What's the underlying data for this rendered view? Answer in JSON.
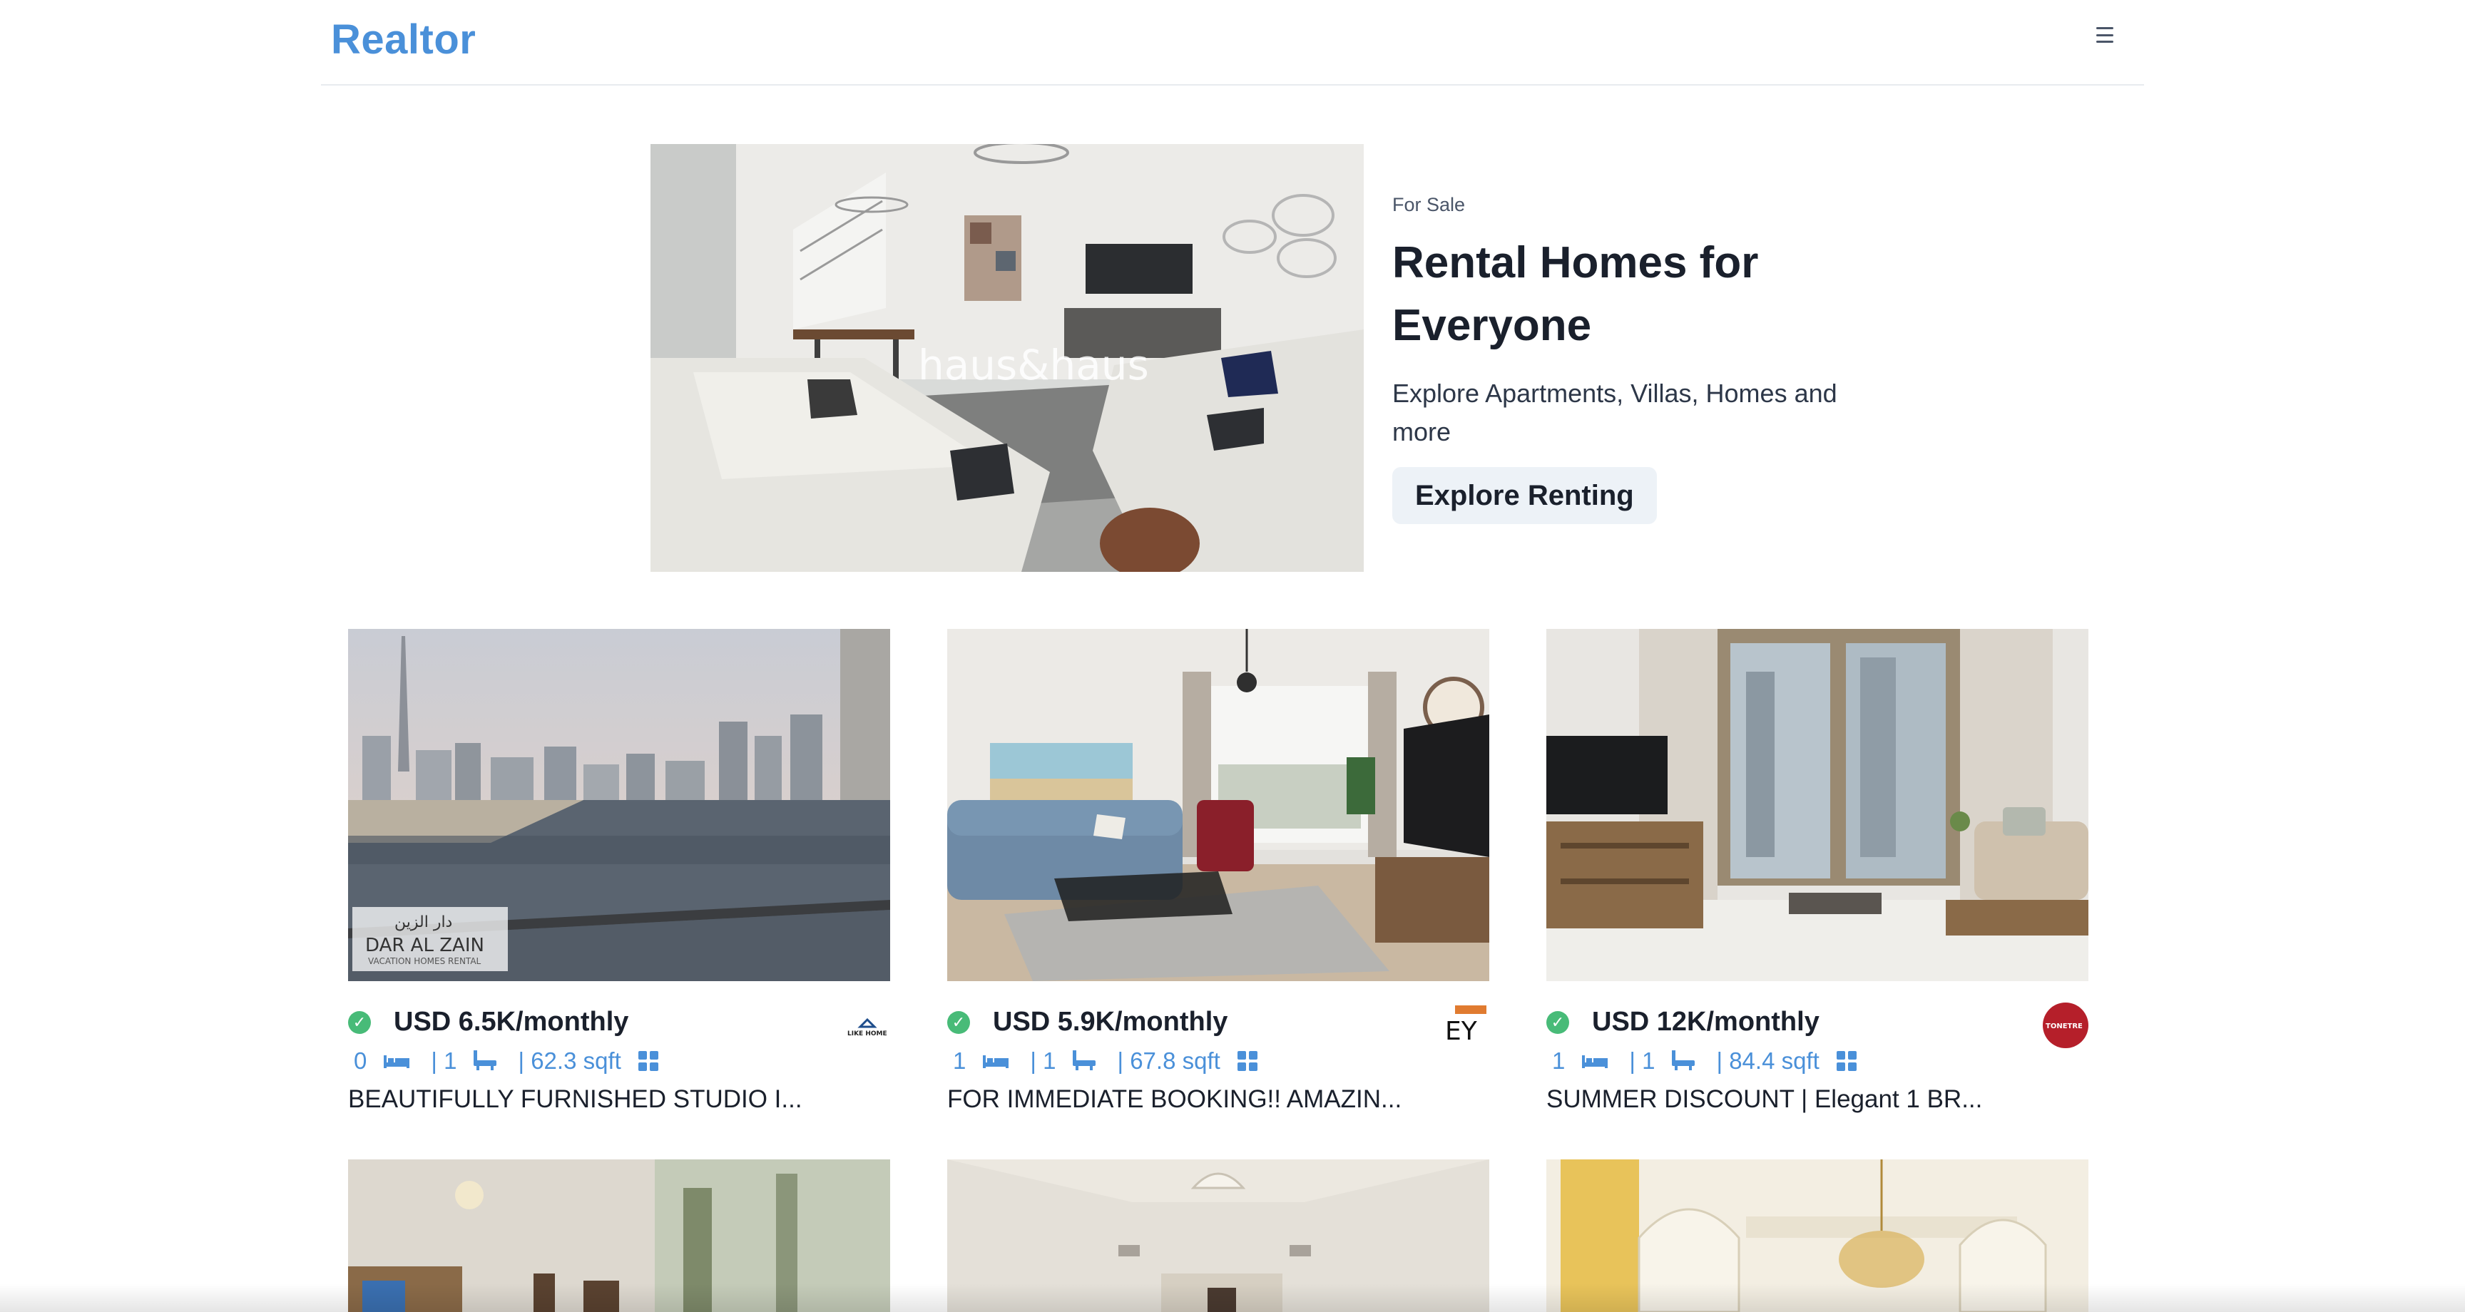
{
  "nav": {
    "brand": "Realtor",
    "menu_icon": "hamburger-menu-icon"
  },
  "hero": {
    "eyebrow": "For Sale",
    "title": "Rental Homes for Everyone",
    "description": "Explore Apartments, Villas, Homes and more",
    "button_label": "Explore Renting",
    "watermark": "haus&haus"
  },
  "listings": [
    {
      "price": "USD 6.5K/monthly",
      "rooms": "0",
      "baths": "| 1",
      "area": "| 62.3 sqft",
      "title": "BEAUTIFULLY FURNISHED STUDIO I...",
      "image_watermark": "DAR AL ZAIN",
      "image_watermark_sub": "VACATION HOMES RENTAL",
      "image_watermark_ar": "دار الزين",
      "agency_logo_text": "LIKE HOME"
    },
    {
      "price": "USD 5.9K/monthly",
      "rooms": "1",
      "baths": "| 1",
      "area": "| 67.8 sqft",
      "title": "FOR IMMEDIATE BOOKING!! AMAZIN...",
      "agency_logo_text": "EY"
    },
    {
      "price": "USD 12K/monthly",
      "rooms": "1",
      "baths": "| 1",
      "area": "| 84.4 sqft",
      "title": "SUMMER DISCOUNT | Elegant 1 BR...",
      "agency_logo_text": "TONETRE"
    }
  ],
  "colors": {
    "brand": "#4a90d9",
    "verified": "#48bb78",
    "meta_text": "#4a90d9",
    "button_bg": "#edf2f7"
  }
}
